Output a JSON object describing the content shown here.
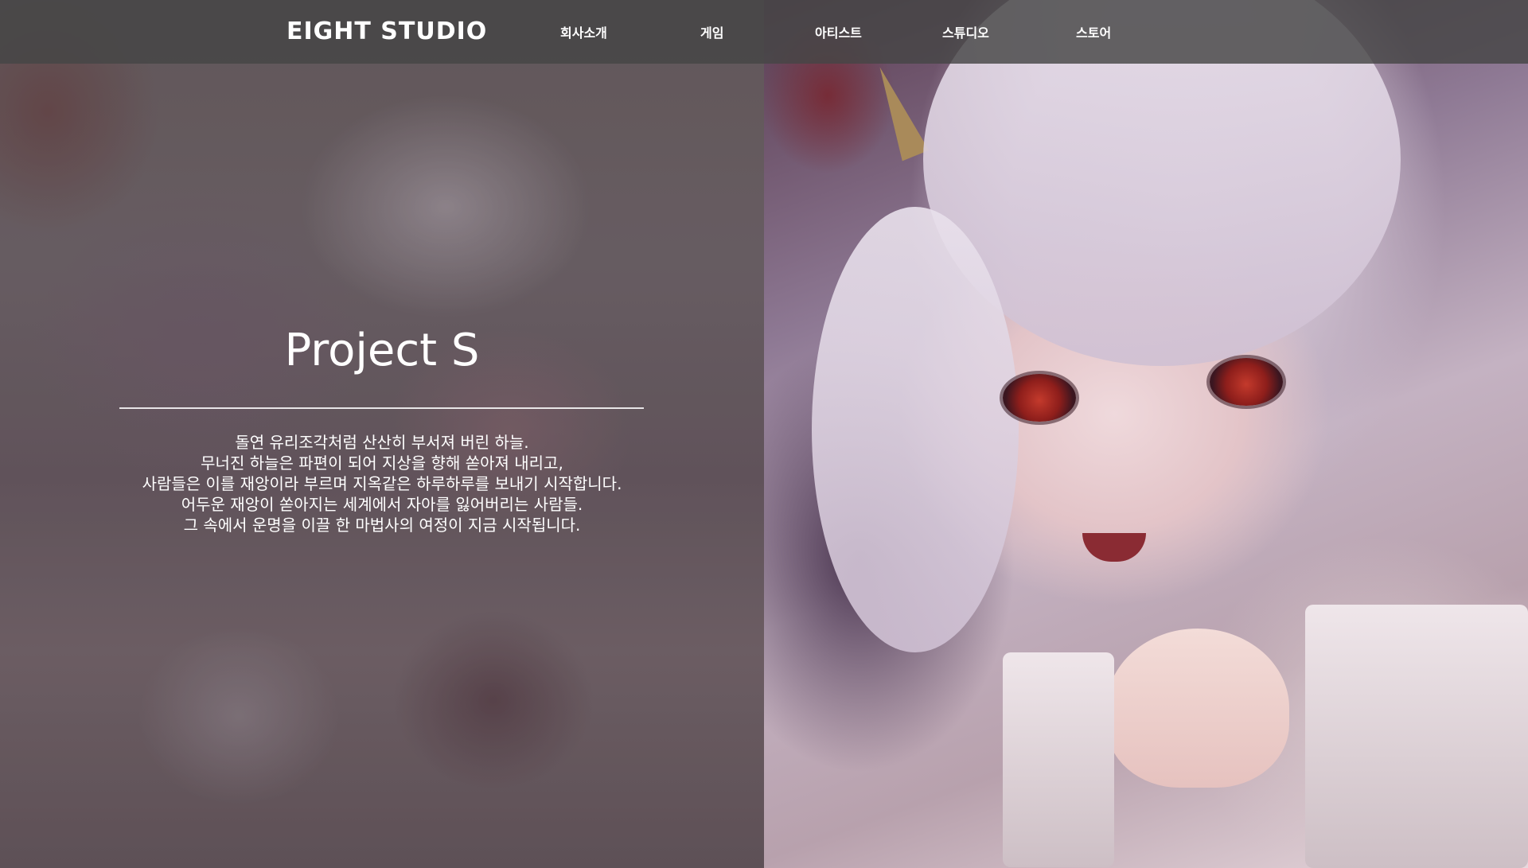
{
  "header": {
    "logo_text": "EIGHT STUDIO",
    "nav": [
      {
        "label": "회사소개"
      },
      {
        "label": "게임"
      },
      {
        "label": "아티스트"
      },
      {
        "label": "스튜디오"
      },
      {
        "label": "스토어"
      }
    ]
  },
  "hero": {
    "title": "Project S",
    "description_lines": [
      "돌연 유리조각처럼 산산히 부서져 버린 하늘.",
      "무너진 하늘은 파편이 되어 지상을 향해 쏟아져 내리고,",
      "사람들은 이를 재앙이라 부르며 지옥같은 하루하루를 보내기 시작합니다.",
      "어두운 재앙이 쏟아지는 세계에서 자아를 잃어버리는 사람들.",
      "그 속에서 운명을 이끌 한 마법사의 여정이 지금 시작됩니다."
    ]
  },
  "colors": {
    "header_bg": "#464646",
    "text": "#ffffff"
  }
}
